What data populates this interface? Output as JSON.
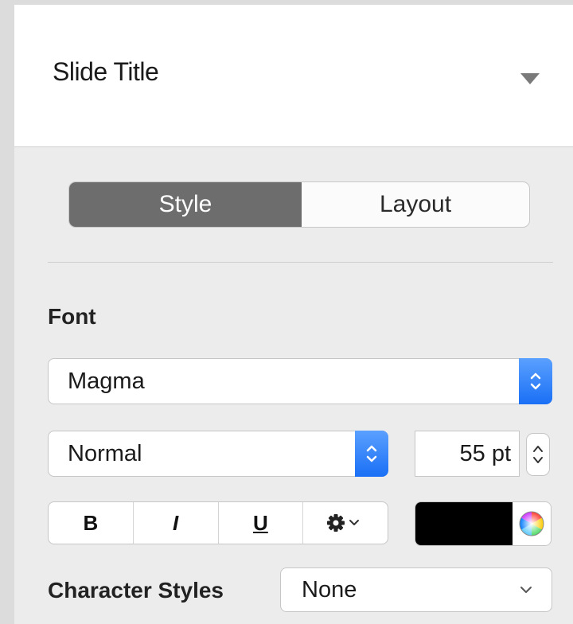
{
  "header": {
    "title": "Slide Title"
  },
  "tabs": {
    "style_label": "Style",
    "layout_label": "Layout",
    "active": "Style"
  },
  "font_section": {
    "label": "Font",
    "font_family": "Magma",
    "font_weight": "Normal",
    "font_size": "55 pt",
    "format_buttons": {
      "bold": "B",
      "italic": "I",
      "underline": "U"
    },
    "text_color": "#000000"
  },
  "character_styles": {
    "label": "Character Styles",
    "value": "None"
  },
  "icons": {
    "header_dropdown": "triangle-down-icon",
    "font_stepper": "updown-chevron-icon",
    "size_stepper": "updown-chevron-icon",
    "advanced_options": "gear-icon",
    "color_picker": "color-wheel-icon",
    "character_styles_dropdown": "chevron-down-icon"
  },
  "colors": {
    "accent_blue": "#1a6ff5",
    "active_tab": "#6d6d6d",
    "panel_bg": "#ececec"
  }
}
